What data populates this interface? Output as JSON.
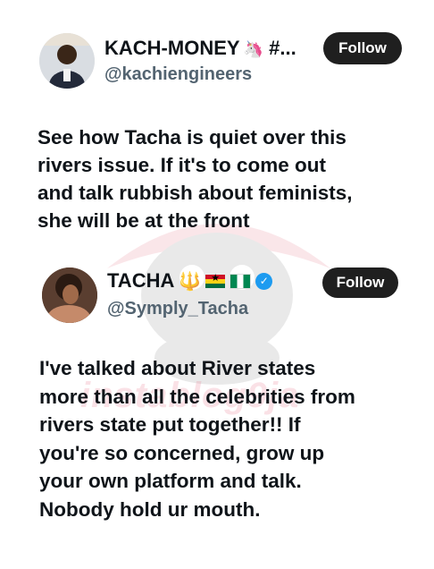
{
  "tweet1": {
    "display_name": "KACH-MONEY",
    "name_suffix": "#...",
    "handle": "@kachiengineers",
    "follow_label": "Follow",
    "text": "See how Tacha is quiet over this\nrivers issue. If it's to come out\nand talk rubbish about feminists,\nshe will be at the front",
    "icons": [
      "unicorn-icon"
    ]
  },
  "tweet2": {
    "display_name": "TACHA",
    "handle": "@Symply_Tacha",
    "follow_label": "Follow",
    "text": "I've talked about River states\nmore than all the celebrities from\nrivers state put together!! If\nyou're so concerned, grow up\nyour own platform and talk.\nNobody hold ur mouth.",
    "icons": [
      "trident-icon",
      "ghana-flag-icon",
      "nigeria-flag-icon",
      "verified-badge-icon"
    ]
  },
  "watermark": {
    "text": "instablog9ja",
    "color": "#e6788c"
  },
  "colors": {
    "follow_bg": "#1f1f1f",
    "handle": "#536471",
    "verified": "#1d9bf0"
  }
}
